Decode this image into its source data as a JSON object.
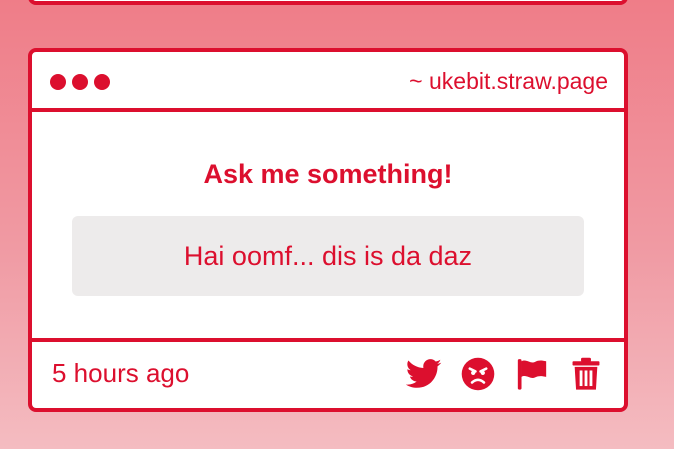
{
  "card": {
    "domain": "~ ukebit.straw.page",
    "title": "Ask me something!",
    "message": "Hai oomf... dis is da daz",
    "timestamp": "5 hours ago"
  },
  "icons": {
    "window_dots": [
      "dot",
      "dot",
      "dot"
    ],
    "actions": [
      "twitter-icon",
      "angry-face-icon",
      "flag-icon",
      "trash-icon"
    ]
  },
  "colors": {
    "accent": "#dc0f2e",
    "card_background": "#ffffff",
    "message_background": "#edebeb",
    "page_gradient_top": "#ef7d88",
    "page_gradient_bottom": "#f4bcc1"
  }
}
